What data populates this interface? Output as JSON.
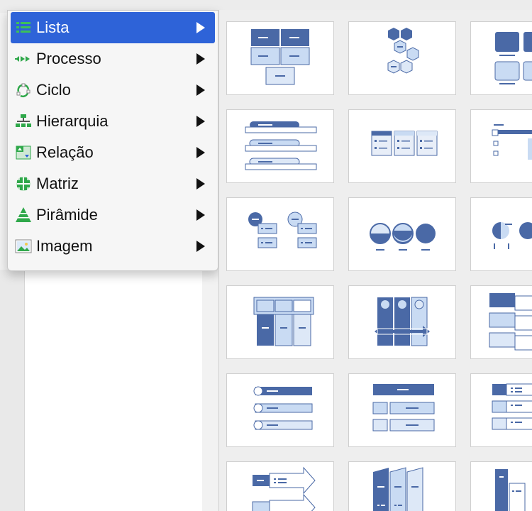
{
  "menu": {
    "items": [
      {
        "label": "Lista",
        "icon": "list-icon",
        "active": true
      },
      {
        "label": "Processo",
        "icon": "process-icon",
        "active": false
      },
      {
        "label": "Ciclo",
        "icon": "cycle-icon",
        "active": false
      },
      {
        "label": "Hierarquia",
        "icon": "hierarchy-icon",
        "active": false
      },
      {
        "label": "Relação",
        "icon": "relationship-icon",
        "active": false
      },
      {
        "label": "Matriz",
        "icon": "matrix-icon",
        "active": false
      },
      {
        "label": "Pirâmide",
        "icon": "pyramid-icon",
        "active": false
      },
      {
        "label": "Imagem",
        "icon": "picture-icon",
        "active": false
      }
    ]
  },
  "gallery": {
    "layouts": [
      "smartart-layout-1",
      "smartart-layout-2",
      "smartart-layout-3",
      "smartart-layout-4",
      "smartart-layout-5",
      "smartart-layout-6",
      "smartart-layout-7",
      "smartart-layout-8",
      "smartart-layout-9",
      "smartart-layout-10",
      "smartart-layout-11",
      "smartart-layout-12",
      "smartart-layout-13",
      "smartart-layout-14",
      "smartart-layout-15",
      "smartart-layout-16",
      "smartart-layout-17",
      "smartart-layout-18"
    ]
  },
  "colors": {
    "accent": "#2e63d8",
    "dark_blue": "#4a69a6",
    "light_blue": "#c9dbf3",
    "icon_green": "#2fa84a"
  }
}
